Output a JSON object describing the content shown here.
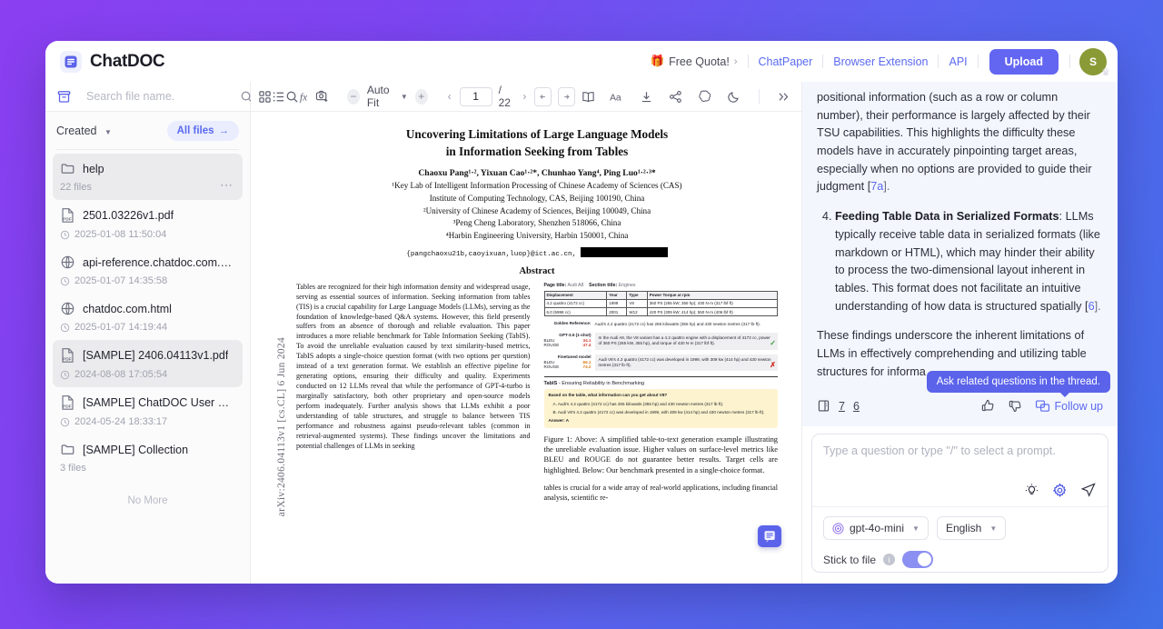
{
  "app": {
    "brand_name": "ChatDOC",
    "logo_icon": "document-logo-icon"
  },
  "header": {
    "quota_label": "Free Quota!",
    "quota_icon": "gift-icon",
    "quota_chevron": "›",
    "links": [
      {
        "label": "ChatPaper",
        "name": "chatpaper-link"
      },
      {
        "label": "Browser Extension",
        "name": "browser-extension-link"
      },
      {
        "label": "API",
        "name": "api-link"
      }
    ],
    "upload_label": "Upload",
    "avatar_initial": "S",
    "avatar_badge": "crown-icon"
  },
  "sidebar": {
    "search_placeholder": "Search file name.",
    "search_value": "",
    "archive_icon": "archive-box-icon",
    "search_icon": "search-icon",
    "sort_label": "Created",
    "all_files_label": "All files",
    "all_files_arrow": "→",
    "no_more_label": "No More",
    "files": [
      {
        "name": "help",
        "icon": "folder-icon",
        "meta": "22 files",
        "selected": true,
        "has_dots": true
      },
      {
        "name": "2501.03226v1.pdf",
        "icon": "pdf-icon",
        "meta": "2025-01-08 11:50:04",
        "selected": false,
        "has_dots": false
      },
      {
        "name": "api-reference.chatdoc.com.h…",
        "icon": "globe-icon",
        "meta": "2025-01-07 14:35:58",
        "selected": false,
        "has_dots": false
      },
      {
        "name": "chatdoc.com.html",
        "icon": "globe-icon",
        "meta": "2025-01-07 14:19:44",
        "selected": false,
        "has_dots": false
      },
      {
        "name": "[SAMPLE] 2406.04113v1.pdf",
        "icon": "pdf-icon",
        "meta": "2024-08-08 17:05:54",
        "selected": true,
        "has_dots": false
      },
      {
        "name": "[SAMPLE] ChatDOC User Guid…",
        "icon": "pdf-icon",
        "meta": "2024-05-24 18:33:17",
        "selected": false,
        "has_dots": false
      },
      {
        "name": "[SAMPLE] Collection",
        "icon": "folder-icon",
        "meta": "3 files",
        "selected": false,
        "has_dots": false
      }
    ]
  },
  "viewer_toolbar": {
    "left_icons": [
      {
        "name": "thumbnails-grid-icon"
      },
      {
        "name": "outline-list-icon"
      },
      {
        "name": "search-icon"
      },
      {
        "name": "formula-fx-icon"
      },
      {
        "name": "screenshot-capture-icon"
      }
    ],
    "zoom_out_label": "−",
    "zoom_in_label": "+",
    "zoom_level_label": "Auto Fit",
    "page_prev": "‹",
    "page_next": "›",
    "page_current": "1",
    "page_total": "/ 22",
    "prev_view_icon": "arrow-left-box-icon",
    "next_view_icon": "arrow-right-box-icon",
    "right_icons": [
      {
        "name": "book-reading-mode-icon"
      },
      {
        "name": "font-size-aa-icon"
      },
      {
        "name": "download-icon"
      },
      {
        "name": "share-icon"
      },
      {
        "name": "ai-swirl-icon"
      },
      {
        "name": "dark-mode-moon-icon"
      },
      {
        "name": "expand-chevrons-icon"
      }
    ]
  },
  "document": {
    "arxiv_stamp": "arXiv:2406.04113v1  [cs.CL]  6 Jun 2024",
    "title_line1": "Uncovering Limitations of Large Language Models",
    "title_line2": "in Information Seeking from Tables",
    "authors": "Chaoxu Pang¹·², Yixuan Cao¹·²*, Chunhao Yang⁴, Ping Luo¹·²·³*",
    "affiliations": [
      "¹Key Lab of Intelligent Information Processing of Chinese Academy of Sciences (CAS)",
      "Institute of Computing Technology, CAS, Beijing 100190, China",
      "²University of Chinese Academy of Sciences, Beijing 100049, China",
      "³Peng Cheng Laboratory, Shenzhen 518066, China",
      "⁴Harbin Engineering University, Harbin 150001, China"
    ],
    "email_line": "{pangchaoxu21b,caoyixuan,luop}@ict.ac.cn,",
    "abstract_heading": "Abstract",
    "abstract_text": "Tables are recognized for their high information density and widespread usage, serving as essential sources of information. Seeking information from tables (TIS) is a crucial capability for Large Language Models (LLMs), serving as the foundation of knowledge-based Q&A systems. However, this field presently suffers from an absence of thorough and reliable evaluation. This paper introduces a more reliable benchmark for Table Information Seeking (TabIS). To avoid the unreliable evaluation caused by text similarity-based metrics, TabIS adopts a single-choice question format (with two options per question) instead of a text generation format. We establish an effective pipeline for generating options, ensuring their difficulty and quality. Experiments conducted on 12 LLMs reveal that while the performance of GPT-4-turbo is marginally satisfactory, both other proprietary and open-source models perform inadequately. Further analysis shows that LLMs exhibit a poor understanding of table structures, and struggle to balance between TIS performance and robustness against pseudo-relevant tables (common in retrieval-augmented systems). These findings uncover the limitations and potential challenges of LLMs in seeking",
    "figure": {
      "page_title_label": "Page title:",
      "page_title_value": "Audi A8",
      "section_title_label": "Section title:",
      "section_title_value": "Engines",
      "table_headers": [
        "Displacement",
        "Year",
        "Type",
        "Power Torque at rpm"
      ],
      "table_rows": [
        [
          "4.2 quattro (4172 cc)",
          "1999",
          "V8",
          "360 PS (265 kW; 355 hp); 430 N·m (317 lbf·ft)"
        ],
        [
          "6.0 (5998 cc)",
          "2001",
          "W12",
          "420 PS (309 kW; 414 hp); 550 N·m (406 lbf·ft)"
        ]
      ],
      "golden_label": "Golden Reference:",
      "golden_text": "Audi's 4.2 quattro (4172 cc) has 265 kilowatts (355 hp) and 430 newton metres (317 lb·ft).",
      "rows": [
        {
          "model": "GPT-3.5 (1-shot)",
          "bleu_label": "BLEU",
          "bleu_value": "34.1",
          "rouge_label": "ROUGE",
          "rouge_value": "47.4",
          "text": "In the Audi A8, the V8 variant has a 4.2 quattro engine with a displacement of 4172 cc, power of 360 PS (265 kW, 355 hp), and torque of 430 N·m (317 lbf·ft).",
          "mark": "✓",
          "mark_color": "#3f9b42"
        },
        {
          "model": "Finetuned model",
          "bleu_label": "BLEU",
          "bleu_value": "66.1",
          "rouge_label": "ROUGE",
          "rouge_value": "74.2",
          "text": "Audi V8's 4.2 quattro (4172 cc) was developed in 1999, with 309 kw (414 hp) and 430 newton metres (317 lb·ft).",
          "mark": "✗",
          "mark_color": "#cf2b1f"
        }
      ],
      "tabis_title": "TabIS",
      "tabis_subtitle": " - Ensuring Reliability in Benchmarking",
      "question": "Based on the table, what information can you get about V8?",
      "option_a": "A. Audi's 4.2 quattro (4172 cc) has 265 kilowatts (355 hp) and 430 newton metres (317 lb·ft).",
      "option_b": "B. Audi V8's 4.2 quattro (4172 cc) was developed in 1999, with 309 kw (414 hp) and 430 newton metres (317 lb·ft).",
      "answer": "Answer: A"
    },
    "figure_caption": "Figure 1: Above: A simplified table-to-text generation example illustrating the unreliable evaluation issue. Higher values on surface-level metrics like BLEU and ROUGE do not guarantee better results. Target cells are highlighted. Below: Our benchmark presented in a single-choice format.",
    "col2_tail": "tables is crucial for a wide array of real-world applications, including financial analysis, scientific re-",
    "float_button_icon": "document-chat-icon"
  },
  "chat": {
    "para_1": "positional information (such as a row or column number), their performance is largely affected by their TSU capabilities. This highlights the difficulty these models have in accurately pinpointing target areas, especially when no options are provided to guide their judgment [",
    "para_1_cite": "7a",
    "para_1_end": "].",
    "list_number": "4.",
    "list_item_bold": "Feeding Table Data in Serialized Formats",
    "list_item_text": ": LLMs typically receive table data in serialized formats (like markdown or HTML), which may hinder their ability to process the two-dimensional layout inherent in tables. This format does not facilitate an intuitive understanding of how data is structured spatially [",
    "list_item_cite": "6",
    "list_item_end": "].",
    "para_2": "These findings underscore the inherent limitations of LLMs in effectively comprehending and utilizing table structures for informa",
    "actions": {
      "source_icon": "source-reference-icon",
      "ref_1": "7",
      "ref_2": "6",
      "like_icon": "thumbs-up-icon",
      "dislike_icon": "thumbs-down-icon",
      "followup_icon": "followup-chat-icon",
      "followup_label": "Follow up"
    },
    "tooltip": "Ask related questions in the thread."
  },
  "composer": {
    "placeholder": "Type a question or type \"/\" to select a prompt.",
    "value": "",
    "idea_icon": "lightbulb-icon",
    "settings_icon": "gear-icon",
    "send_icon": "send-paper-plane-icon",
    "model_label": "gpt-4o-mini",
    "model_icon": "openai-swirl-icon",
    "language_label": "English",
    "stick_label": "Stick to file",
    "stick_info_icon": "info-icon",
    "stick_enabled": true
  },
  "colors": {
    "accent": "#5b63ea",
    "link": "#5b6af0",
    "upload_bg": "#6366f1",
    "avatar_bg": "#8a9a36",
    "chat_bg": "#f3f6fd",
    "bg_gradient_from": "#8b3ff0",
    "bg_gradient_to": "#3f6fe8"
  }
}
